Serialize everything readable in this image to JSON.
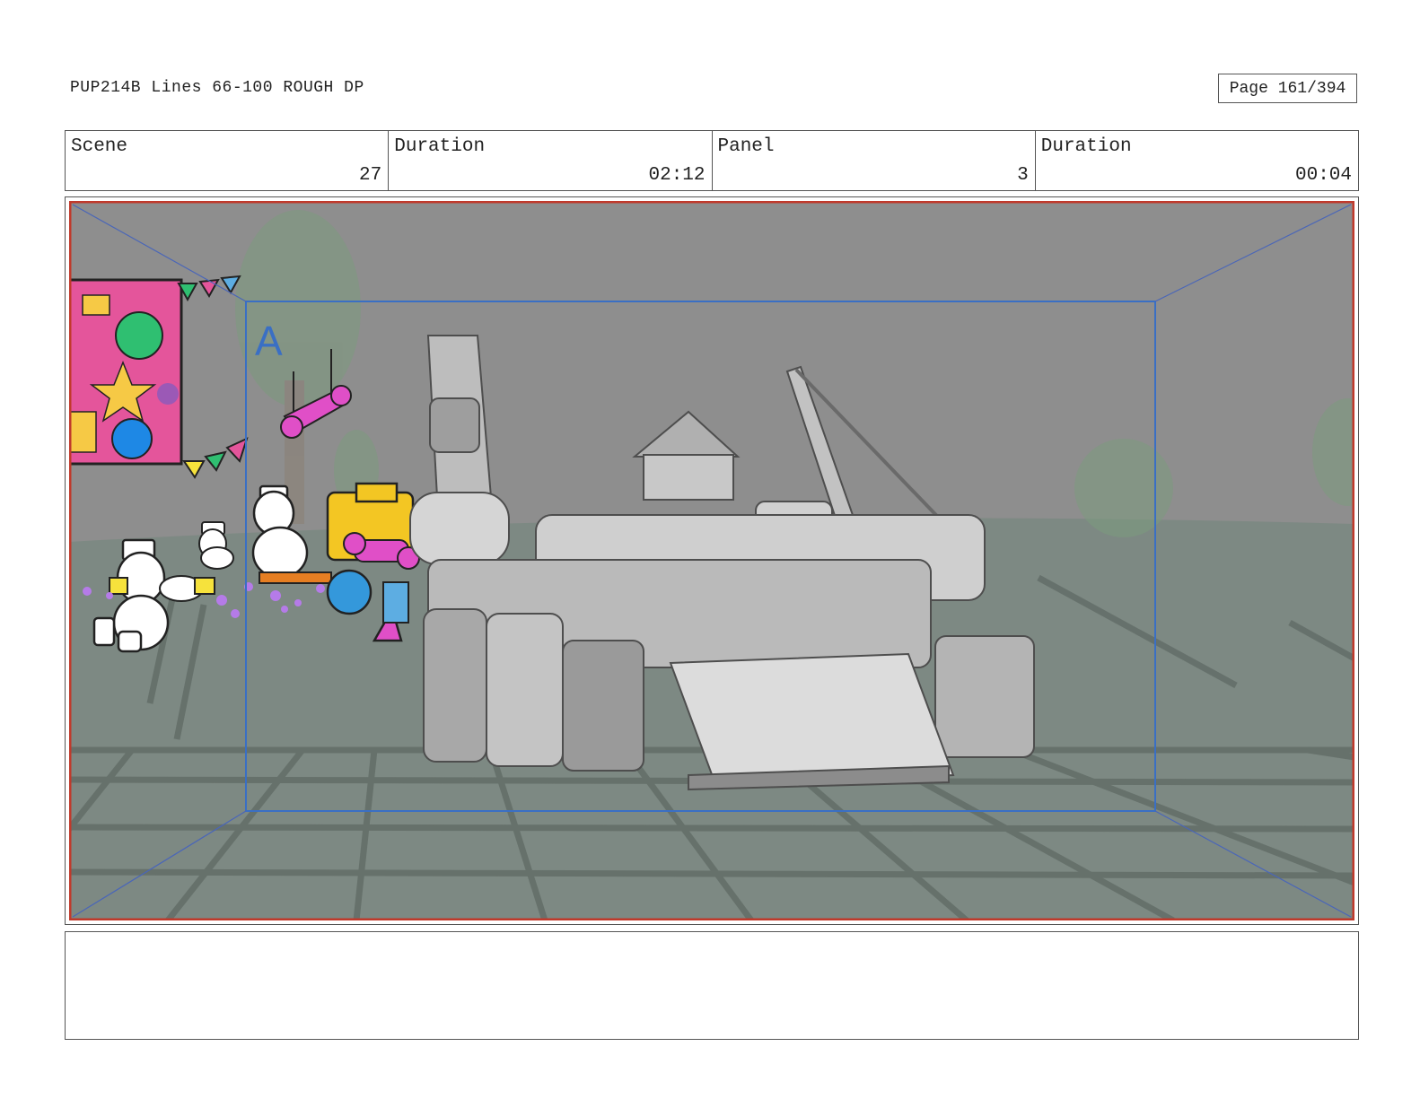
{
  "header": {
    "title": "PUP214B Lines 66-100 ROUGH DP",
    "page": "Page 161/394"
  },
  "info": {
    "scene_label": "Scene",
    "scene_value": "27",
    "scene_duration_label": "Duration",
    "scene_duration_value": "02:12",
    "panel_label": "Panel",
    "panel_value": "3",
    "panel_duration_label": "Duration",
    "panel_duration_value": "00:04"
  },
  "panel": {
    "field_marker": "A",
    "colors": {
      "safe_frame": "#3a6fc4",
      "outer_frame": "#c0392b",
      "background": "#8b8b8b",
      "ground": "#7e8a83"
    }
  },
  "notes": {
    "text": ""
  }
}
